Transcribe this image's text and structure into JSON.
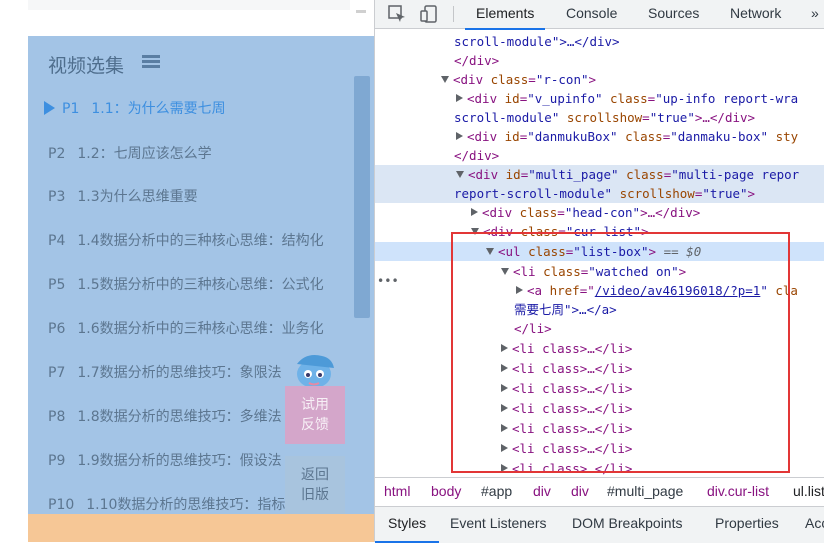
{
  "video_panel": {
    "title": "视频选集",
    "episodes": [
      {
        "num": "P1",
        "title": "1.1：为什么需要七周",
        "active": true
      },
      {
        "num": "P2",
        "title": "1.2：七周应该怎么学"
      },
      {
        "num": "P3",
        "title": "1.3为什么思维重要"
      },
      {
        "num": "P4",
        "title": "1.4数据分析中的三种核心思维：结构化"
      },
      {
        "num": "P5",
        "title": "1.5数据分析中的三种核心思维：公式化"
      },
      {
        "num": "P6",
        "title": "1.6数据分析中的三种核心思维：业务化"
      },
      {
        "num": "P7",
        "title": "1.7数据分析的思维技巧：象限法"
      },
      {
        "num": "P8",
        "title": "1.8数据分析的思维技巧：多维法"
      },
      {
        "num": "P9",
        "title": "1.9数据分析的思维技巧：假设法"
      },
      {
        "num": "P10",
        "title": "1.10数据分析的思维技巧：指标法"
      }
    ],
    "feedback_button": {
      "line1": "试用",
      "line2": "反馈"
    },
    "old_version_button": {
      "line1": "返回",
      "line2": "旧版"
    },
    "colors": {
      "panel": "#a3c4e6",
      "active": "#3d8fe0",
      "feedback": "#d4a6ca",
      "footer": "#f6c796"
    }
  },
  "devtools": {
    "tabs": [
      "Elements",
      "Console",
      "Sources",
      "Network",
      "»"
    ],
    "active_tab": "Elements",
    "dom": {
      "l1": {
        "text": "scroll-module\">…</div>"
      },
      "l2": {
        "text": "</div>"
      },
      "l3": {
        "tag_open": "<div ",
        "attr": "class",
        "val": "\"r-con\"",
        "close": ">"
      },
      "l4": {
        "tag_open": "<div ",
        "a1": "id",
        "v1": "\"v_upinfo\"",
        "a2": "class",
        "v2": "\"up-info report-wra"
      },
      "l5": {
        "v": "scroll-module\" ",
        "a": "scrollshow",
        "v2": "\"true\"",
        "rest": ">…</div>"
      },
      "l6": {
        "tag_open": "<div ",
        "a1": "id",
        "v1": "\"danmukuBox\"",
        "a2": "class",
        "v2": "\"danmaku-box\"",
        "a3": "sty"
      },
      "l7": {
        "text": "</div>"
      },
      "l8": {
        "tag_open": "<div ",
        "a1": "id",
        "v1": "\"multi_page\"",
        "a2": "class",
        "v2": "\"multi-page repor"
      },
      "l9": {
        "v": "report-scroll-module\" ",
        "a": "scrollshow",
        "v2": "\"true\"",
        "rest": ">"
      },
      "l10": {
        "tag_open": "<div ",
        "a": "class",
        "v": "\"head-con\"",
        "rest": ">…</div>"
      },
      "l11": {
        "tag_open": "<div ",
        "a": "class",
        "v": "\"cur-list\"",
        "rest": ">"
      },
      "l12": {
        "tag_open": "<ul ",
        "a": "class",
        "v": "\"list-box\"",
        "rest": ">",
        "eq": " == $0"
      },
      "l13": {
        "tag_open": "<li ",
        "a": "class",
        "v": "\"watched on\"",
        "rest": ">"
      },
      "l14": {
        "tag_open": "<a ",
        "a": "href",
        "link": "/video/av46196018/?p=1",
        "rest": " cla"
      },
      "l15": {
        "text": "需要七周\">…</a>"
      },
      "l16": {
        "text": "</li>"
      },
      "li_collapsed": "<li class>…</li>"
    },
    "breadcrumbs": [
      "html",
      "body",
      "#app",
      "div",
      "div",
      "#multi_page",
      "div.cur-list",
      "ul.list"
    ],
    "sub_tabs": [
      "Styles",
      "Event Listeners",
      "DOM Breakpoints",
      "Properties",
      "Acc"
    ],
    "active_sub_tab": "Styles"
  }
}
